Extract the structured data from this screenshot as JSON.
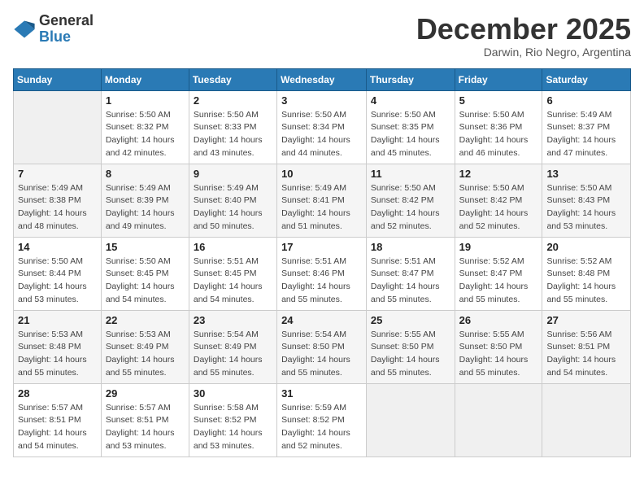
{
  "logo": {
    "general": "General",
    "blue": "Blue"
  },
  "title": "December 2025",
  "location": "Darwin, Rio Negro, Argentina",
  "weekdays": [
    "Sunday",
    "Monday",
    "Tuesday",
    "Wednesday",
    "Thursday",
    "Friday",
    "Saturday"
  ],
  "weeks": [
    [
      {
        "num": "",
        "empty": true
      },
      {
        "num": "1",
        "sunrise": "5:50 AM",
        "sunset": "8:32 PM",
        "daylight": "14 hours and 42 minutes."
      },
      {
        "num": "2",
        "sunrise": "5:50 AM",
        "sunset": "8:33 PM",
        "daylight": "14 hours and 43 minutes."
      },
      {
        "num": "3",
        "sunrise": "5:50 AM",
        "sunset": "8:34 PM",
        "daylight": "14 hours and 44 minutes."
      },
      {
        "num": "4",
        "sunrise": "5:50 AM",
        "sunset": "8:35 PM",
        "daylight": "14 hours and 45 minutes."
      },
      {
        "num": "5",
        "sunrise": "5:50 AM",
        "sunset": "8:36 PM",
        "daylight": "14 hours and 46 minutes."
      },
      {
        "num": "6",
        "sunrise": "5:49 AM",
        "sunset": "8:37 PM",
        "daylight": "14 hours and 47 minutes."
      }
    ],
    [
      {
        "num": "7",
        "sunrise": "5:49 AM",
        "sunset": "8:38 PM",
        "daylight": "14 hours and 48 minutes."
      },
      {
        "num": "8",
        "sunrise": "5:49 AM",
        "sunset": "8:39 PM",
        "daylight": "14 hours and 49 minutes."
      },
      {
        "num": "9",
        "sunrise": "5:49 AM",
        "sunset": "8:40 PM",
        "daylight": "14 hours and 50 minutes."
      },
      {
        "num": "10",
        "sunrise": "5:49 AM",
        "sunset": "8:41 PM",
        "daylight": "14 hours and 51 minutes."
      },
      {
        "num": "11",
        "sunrise": "5:50 AM",
        "sunset": "8:42 PM",
        "daylight": "14 hours and 52 minutes."
      },
      {
        "num": "12",
        "sunrise": "5:50 AM",
        "sunset": "8:42 PM",
        "daylight": "14 hours and 52 minutes."
      },
      {
        "num": "13",
        "sunrise": "5:50 AM",
        "sunset": "8:43 PM",
        "daylight": "14 hours and 53 minutes."
      }
    ],
    [
      {
        "num": "14",
        "sunrise": "5:50 AM",
        "sunset": "8:44 PM",
        "daylight": "14 hours and 53 minutes."
      },
      {
        "num": "15",
        "sunrise": "5:50 AM",
        "sunset": "8:45 PM",
        "daylight": "14 hours and 54 minutes."
      },
      {
        "num": "16",
        "sunrise": "5:51 AM",
        "sunset": "8:45 PM",
        "daylight": "14 hours and 54 minutes."
      },
      {
        "num": "17",
        "sunrise": "5:51 AM",
        "sunset": "8:46 PM",
        "daylight": "14 hours and 55 minutes."
      },
      {
        "num": "18",
        "sunrise": "5:51 AM",
        "sunset": "8:47 PM",
        "daylight": "14 hours and 55 minutes."
      },
      {
        "num": "19",
        "sunrise": "5:52 AM",
        "sunset": "8:47 PM",
        "daylight": "14 hours and 55 minutes."
      },
      {
        "num": "20",
        "sunrise": "5:52 AM",
        "sunset": "8:48 PM",
        "daylight": "14 hours and 55 minutes."
      }
    ],
    [
      {
        "num": "21",
        "sunrise": "5:53 AM",
        "sunset": "8:48 PM",
        "daylight": "14 hours and 55 minutes."
      },
      {
        "num": "22",
        "sunrise": "5:53 AM",
        "sunset": "8:49 PM",
        "daylight": "14 hours and 55 minutes."
      },
      {
        "num": "23",
        "sunrise": "5:54 AM",
        "sunset": "8:49 PM",
        "daylight": "14 hours and 55 minutes."
      },
      {
        "num": "24",
        "sunrise": "5:54 AM",
        "sunset": "8:50 PM",
        "daylight": "14 hours and 55 minutes."
      },
      {
        "num": "25",
        "sunrise": "5:55 AM",
        "sunset": "8:50 PM",
        "daylight": "14 hours and 55 minutes."
      },
      {
        "num": "26",
        "sunrise": "5:55 AM",
        "sunset": "8:50 PM",
        "daylight": "14 hours and 55 minutes."
      },
      {
        "num": "27",
        "sunrise": "5:56 AM",
        "sunset": "8:51 PM",
        "daylight": "14 hours and 54 minutes."
      }
    ],
    [
      {
        "num": "28",
        "sunrise": "5:57 AM",
        "sunset": "8:51 PM",
        "daylight": "14 hours and 54 minutes."
      },
      {
        "num": "29",
        "sunrise": "5:57 AM",
        "sunset": "8:51 PM",
        "daylight": "14 hours and 53 minutes."
      },
      {
        "num": "30",
        "sunrise": "5:58 AM",
        "sunset": "8:52 PM",
        "daylight": "14 hours and 53 minutes."
      },
      {
        "num": "31",
        "sunrise": "5:59 AM",
        "sunset": "8:52 PM",
        "daylight": "14 hours and 52 minutes."
      },
      {
        "num": "",
        "empty": true
      },
      {
        "num": "",
        "empty": true
      },
      {
        "num": "",
        "empty": true
      }
    ]
  ]
}
